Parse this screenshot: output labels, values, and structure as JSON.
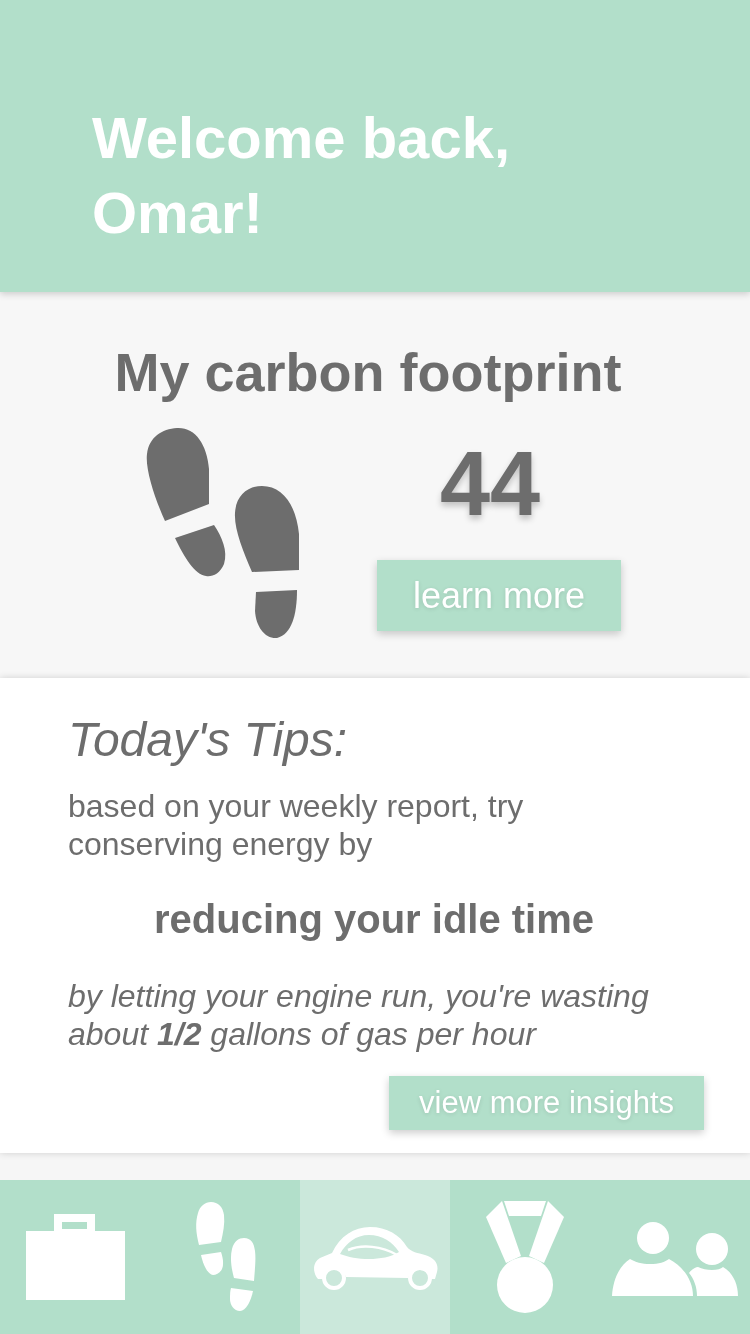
{
  "header": {
    "title": "Welcome back, Omar!"
  },
  "footprint": {
    "title": "My carbon footprint",
    "score": "44",
    "button": "learn more"
  },
  "tips": {
    "title": "Today's Tips:",
    "intro": "based on your weekly report, try conserving energy by",
    "action": "reducing your idle time",
    "detail": "by letting your engine run, you're wasting about **1/2** gallons of gas per hour",
    "button": "view more insights"
  },
  "nav": [
    {
      "kind": "briefcase",
      "selected": false
    },
    {
      "kind": "footprints",
      "selected": false
    },
    {
      "kind": "car",
      "selected": true
    },
    {
      "kind": "medal",
      "selected": false
    },
    {
      "kind": "people",
      "selected": false
    }
  ]
}
